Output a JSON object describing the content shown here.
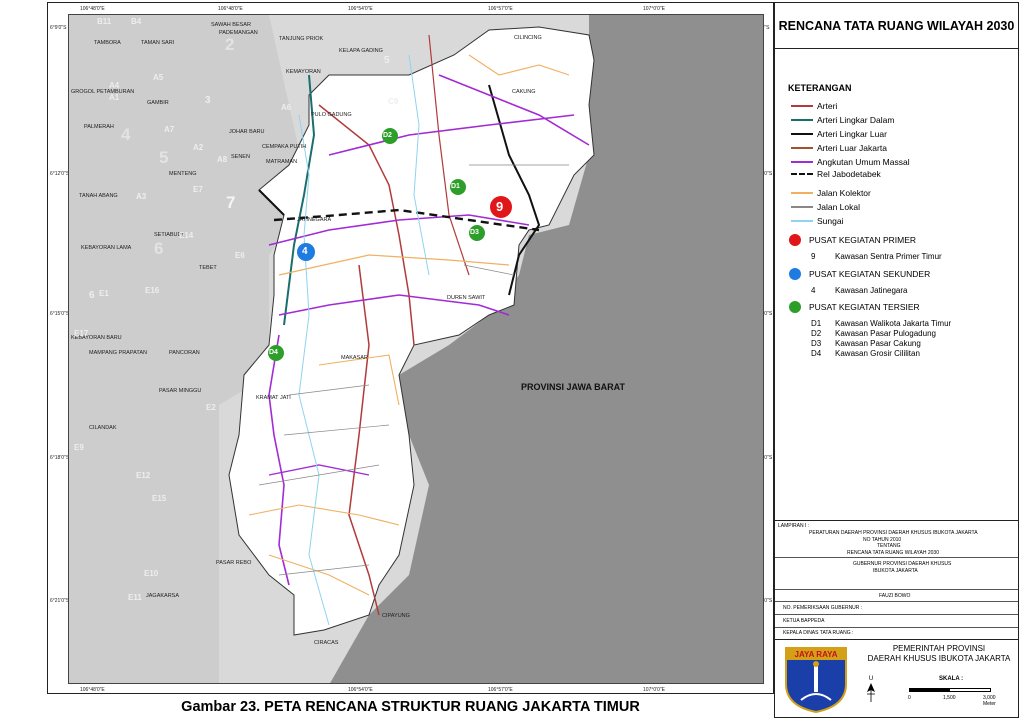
{
  "panel": {
    "title": "RENCANA TATA RUANG WILAYAH 2030",
    "legend_heading": "KETERANGAN",
    "roads": [
      {
        "label": "Arteri",
        "color": "#b23a3a",
        "style": "solid"
      },
      {
        "label": "Arteri Lingkar Dalam",
        "color": "#1b6e6e",
        "style": "solid"
      },
      {
        "label": "Arteri Lingkar Luar",
        "color": "#111111",
        "style": "solid"
      },
      {
        "label": "Arteri Luar Jakarta",
        "color": "#a0522d",
        "style": "solid"
      },
      {
        "label": "Angkutan Umum Massal",
        "color": "#a12bd6",
        "style": "solid"
      },
      {
        "label": "Rel Jabodetabek",
        "color": "#111111",
        "style": "dashed"
      },
      {
        "label": "Jalan Kolektor",
        "color": "#f0b060",
        "style": "solid"
      },
      {
        "label": "Jalan Lokal",
        "color": "#888888",
        "style": "solid"
      },
      {
        "label": "Sungai",
        "color": "#8fd3f0",
        "style": "solid"
      }
    ],
    "centers": [
      {
        "label": "PUSAT KEGIATAN PRIMER",
        "color": "#e0161b",
        "items": [
          {
            "code": "9",
            "name": "Kawasan Sentra Primer Timur"
          }
        ]
      },
      {
        "label": "PUSAT KEGIATAN SEKUNDER",
        "color": "#1e7be0",
        "items": [
          {
            "code": "4",
            "name": "Kawasan Jatinegara"
          }
        ]
      },
      {
        "label": "PUSAT KEGIATAN TERSIER",
        "color": "#2e9e2a",
        "items": [
          {
            "code": "D1",
            "name": "Kawasan Walikota Jakarta Timur"
          },
          {
            "code": "D2",
            "name": "Kawasan Pasar Pulogadung"
          },
          {
            "code": "D3",
            "name": "Kawasan Pasar Cakung"
          },
          {
            "code": "D4",
            "name": "Kawasan Grosir Cililitan"
          }
        ]
      }
    ],
    "lampiran": {
      "label": "LAMPIRAN I :",
      "line1": "PERATURAN DAERAH PROVINSI DAERAH KHUSUS IBUKOTA JAKARTA",
      "line2": "NO    TAHUN 2010",
      "line3": "TENTANG",
      "line4": "RENCANA TATA RUANG WILAYAH 2030",
      "gov1": "GUBERNUR PROVINSI DAERAH KHUSUS",
      "gov2": "IBUKOTA JAKARTA",
      "name": "FAUZI BOWO",
      "sign1": "NO. PEMERIKSAAN GUBERNUR :",
      "sign2": "KETUA BAPPEDA",
      "sign3": "KEPALA DINAS TATA RUANG :"
    },
    "government": {
      "line1": "PEMERINTAH PROVINSI",
      "line2": "DAERAH KHUSUS IBUKOTA JAKARTA"
    },
    "logo_text": "JAYA RAYA",
    "scale": {
      "label": "SKALA :",
      "n0": "0",
      "n1": "1,500",
      "n2": "3,000",
      "unit": "Meter"
    }
  },
  "caption": "Gambar 23. PETA RENCANA STRUKTUR RUANG JAKARTA TIMUR",
  "map": {
    "region_label": "PROVINSI JAWA BARAT",
    "ticks_top": [
      "106°48'0\"E",
      "106°51'0\"E",
      "106°54'0\"E",
      "106°57'0\"E",
      "107°0'0\"E"
    ],
    "ticks_left": [
      "6°9'0\"S",
      "6°12'0\"S",
      "6°15'0\"S",
      "6°18'0\"S",
      "6°21'0\"S"
    ],
    "place_labels": [
      "SAWAH BESAR",
      "TAMBORA",
      "TAMAN SARI",
      "PADEMANGAN",
      "TANJUNG PRIOK",
      "KELAPA GADING",
      "CILINCING",
      "GROGOL PETAMBURAN",
      "GAMBIR",
      "KEMAYORAN",
      "PULO GADUNG",
      "CAKUNG",
      "PALMERAH",
      "JOHAR BARU",
      "CEMPAKA PUTIH",
      "SENEN",
      "MATRAMAN",
      "MENTENG",
      "TANAH ABANG",
      "JATINEGARA",
      "SETIABUDI",
      "KEBAYORAN LAMA",
      "TEBET",
      "DUREN SAWIT",
      "KEBAYORAN BARU",
      "MAMPANG PRAPATAN",
      "PANCORAN",
      "MAKASAR",
      "PASAR MINGGU",
      "KRAMAT JATI",
      "CILANDAK",
      "PASAR REBO",
      "JAGAKARSA",
      "CIRACAS",
      "CIPAYUNG"
    ],
    "grey_codes": [
      "B11",
      "B4",
      "2",
      "A4",
      "A5",
      "A1",
      "3",
      "5",
      "A6",
      "C9",
      "4",
      "A7",
      "5",
      "A2",
      "A8",
      "E7",
      "7",
      "A3",
      "E14",
      "6",
      "E6",
      "6",
      "E16",
      "E1",
      "E17",
      "E2",
      "E9",
      "E12",
      "E15",
      "E10",
      "E11"
    ],
    "markers": [
      {
        "code": "9",
        "color": "#e0161b"
      },
      {
        "code": "4",
        "color": "#1e7be0"
      },
      {
        "code": "D1",
        "color": "#2e9e2a"
      },
      {
        "code": "D2",
        "color": "#2e9e2a"
      },
      {
        "code": "D3",
        "color": "#2e9e2a"
      },
      {
        "code": "D4",
        "color": "#2e9e2a"
      }
    ]
  }
}
